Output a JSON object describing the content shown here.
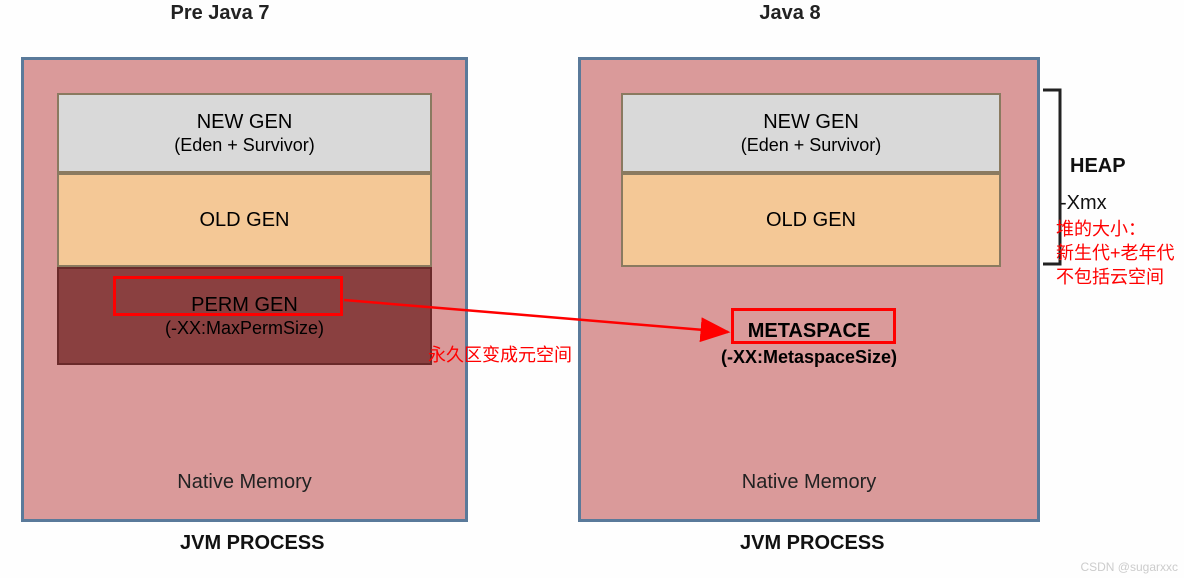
{
  "titles": {
    "left": "Pre Java 7",
    "right": "Java 8"
  },
  "newgen": {
    "line1": "NEW GEN",
    "line2": "(Eden + Survivor)"
  },
  "oldgen": {
    "label": "OLD GEN"
  },
  "permgen": {
    "line1": "PERM GEN",
    "line2": "(-XX:MaxPermSize)"
  },
  "metaspace": {
    "line1": "METASPACE",
    "line2": "(-XX:MetaspaceSize)"
  },
  "native": "Native Memory",
  "footer": "JVM PROCESS",
  "side": {
    "heap": "HEAP",
    "xmx": "-Xmx",
    "note1": "堆的大小：",
    "note2": "新生代+老年代",
    "note3": "不包括云空间"
  },
  "annotation": "永久区变成元空间",
  "watermark": "CSDN @sugarxxc"
}
